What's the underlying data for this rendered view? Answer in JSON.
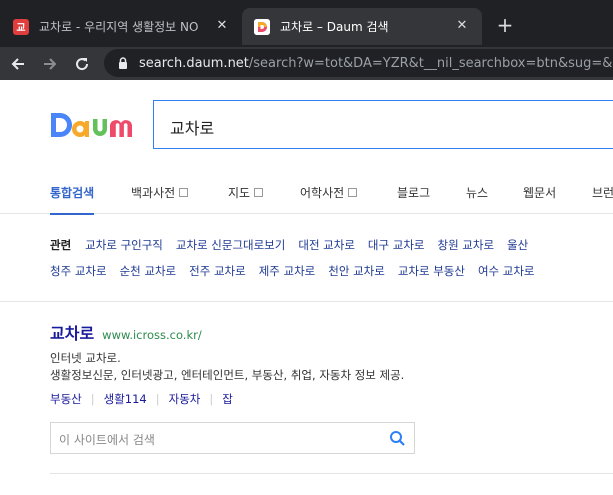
{
  "browser": {
    "tabs": [
      {
        "favicon": "교",
        "title": "교차로 - 우리지역 생활정보 NO",
        "active": false
      },
      {
        "favicon": "D",
        "title": "교차로 – Daum 검색",
        "active": true
      }
    ],
    "new_tab_icon": "plus-icon",
    "url_host": "search.daum.net",
    "url_path": "/search?w=tot&DA=YZR&t__nil_searchbox=btn&sug=&sug"
  },
  "daum": {
    "logo_text": "Daum",
    "logo_colors": [
      "#4a86f7",
      "#f7a92a",
      "#62c15c",
      "#ee4b6a"
    ],
    "query": "교차로",
    "tabs": [
      {
        "label": "통합검색",
        "active": true,
        "checkbox": false
      },
      {
        "label": "백과사전",
        "active": false,
        "checkbox": true
      },
      {
        "label": "지도",
        "active": false,
        "checkbox": true
      },
      {
        "label": "어학사전",
        "active": false,
        "checkbox": true
      },
      {
        "label": "블로그",
        "active": false,
        "checkbox": false
      },
      {
        "label": "뉴스",
        "active": false,
        "checkbox": false
      },
      {
        "label": "웹문서",
        "active": false,
        "checkbox": false
      },
      {
        "label": "브런",
        "active": false,
        "checkbox": false
      }
    ],
    "related": {
      "label": "관련",
      "row1": [
        "교차로 구인구직",
        "교차로 신문그대로보기",
        "대전 교차로",
        "대구 교차로",
        "창원 교차로",
        "울산"
      ],
      "row2": [
        "청주 교차로",
        "순천 교차로",
        "전주 교차로",
        "제주 교차로",
        "천안 교차로",
        "교차로 부동산",
        "여수 교차로"
      ]
    },
    "result": {
      "title": "교차로",
      "url": "www.icross.co.kr/",
      "desc_line1": "인터넷 교차로.",
      "desc_line2": "생활정보신문, 인터넷광고, 엔터테인먼트, 부동산, 취업, 자동차 정보 제공.",
      "links": [
        "부동산",
        "생활114",
        "자동차",
        "잡"
      ],
      "site_search_placeholder": "이 사이트에서 검색"
    }
  }
}
